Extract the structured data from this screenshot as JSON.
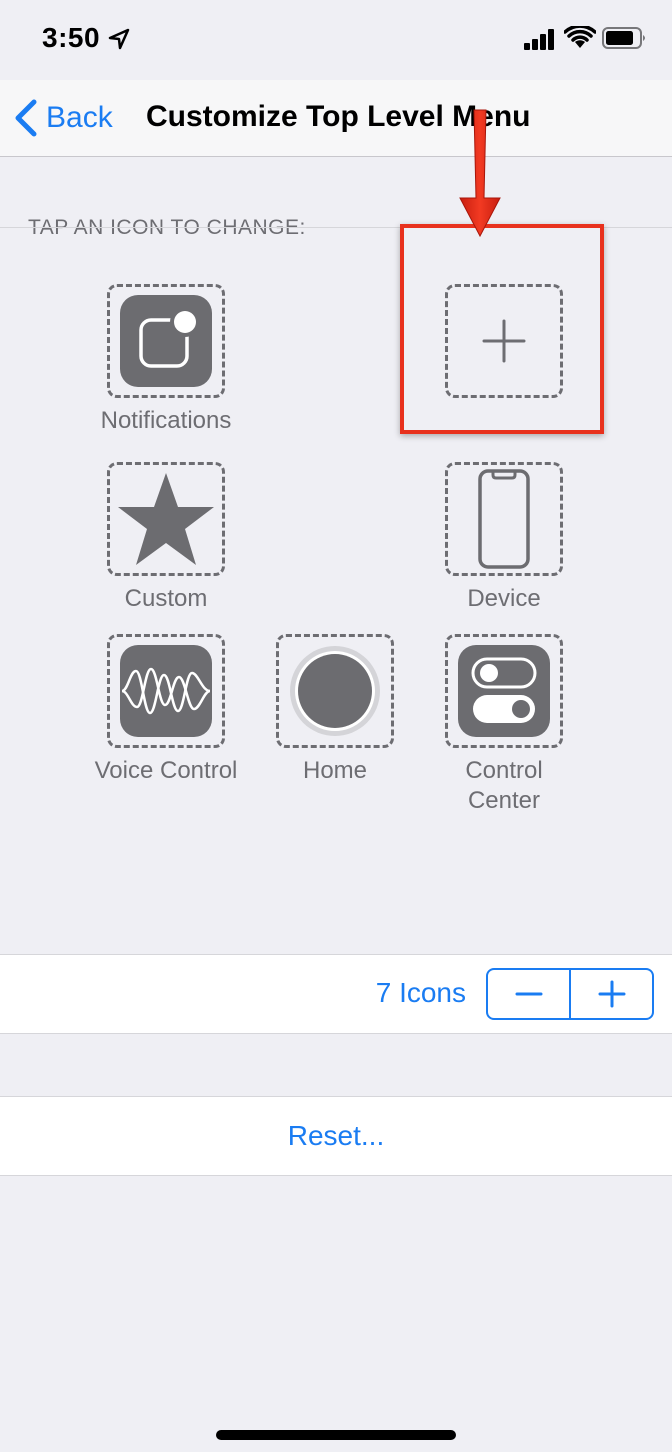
{
  "status_bar": {
    "time": "3:50",
    "icons": [
      "location-icon",
      "signal-icon",
      "wifi-icon",
      "battery-icon"
    ]
  },
  "nav": {
    "back_label": "Back",
    "title": "Customize Top Level Menu"
  },
  "section_header": "TAP AN ICON TO CHANGE:",
  "slots": [
    {
      "label": "Notifications",
      "icon": "notifications-icon"
    },
    {
      "label": "",
      "icon": "add-icon"
    },
    {
      "label": "Custom",
      "icon": "star-icon"
    },
    {
      "label": "Device",
      "icon": "device-icon"
    },
    {
      "label": "Voice Control",
      "icon": "waveform-icon"
    },
    {
      "label": "Home",
      "icon": "home-circle-icon"
    },
    {
      "label": "Control\nCenter",
      "icon": "toggles-icon"
    }
  ],
  "icon_count": {
    "label": "7 Icons",
    "minus_label": "−",
    "plus_label": "+"
  },
  "reset_label": "Reset...",
  "colors": {
    "accent": "#1a7cf2",
    "background": "#efeff4",
    "icon_gray": "#6c6c70",
    "highlight_red": "#e8311d"
  }
}
